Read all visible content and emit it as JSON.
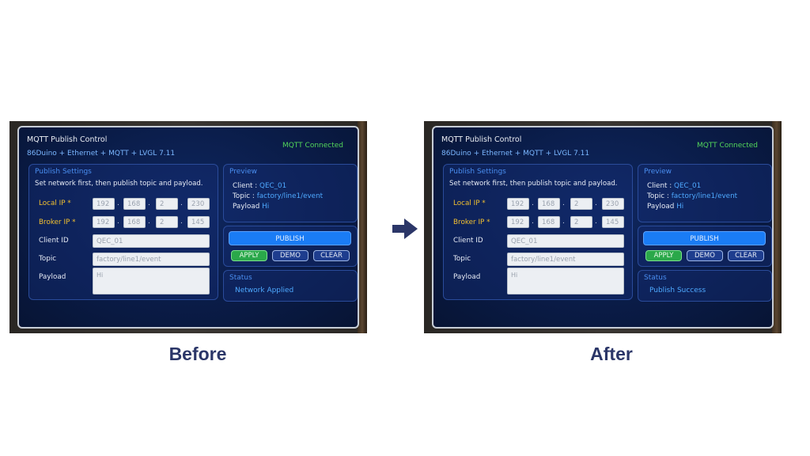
{
  "colors": {
    "caption": "#2b3668",
    "accent_blue": "#1a7cf5",
    "connected_green": "#53d65a",
    "required_label": "#f2c030",
    "screen_bg": "#0a1c48"
  },
  "arrow_icon": "right-arrow-icon",
  "panels": [
    {
      "caption": "Before",
      "header": {
        "title": "MQTT Publish Control",
        "subtitle": "86Duino + Ethernet + MQTT + LVGL 7.11",
        "connection": "MQTT Connected"
      },
      "settings": {
        "title": "Publish Settings",
        "hint": "Set network first, then publish topic and payload.",
        "local_ip_label": "Local IP *",
        "local_ip": [
          "192",
          "168",
          "2",
          "230"
        ],
        "broker_ip_label": "Broker IP *",
        "broker_ip": [
          "192",
          "168",
          "2",
          "145"
        ],
        "client_id_label": "Client ID",
        "client_id": "QEC_01",
        "topic_label": "Topic",
        "topic": "factory/line1/event",
        "payload_label": "Payload",
        "payload": "Hi"
      },
      "preview": {
        "title": "Preview",
        "client_label": "Client :",
        "client": "QEC_01",
        "topic_label": "Topic :",
        "topic": "factory/line1/event",
        "payload_label": "Payload",
        "payload": "Hi"
      },
      "buttons": {
        "publish": "PUBLISH",
        "apply": "APPLY",
        "demo": "DEMO",
        "clear": "CLEAR"
      },
      "status": {
        "title": "Status",
        "text": "Network Applied"
      }
    },
    {
      "caption": "After",
      "header": {
        "title": "MQTT Publish Control",
        "subtitle": "86Duino + Ethernet + MQTT + LVGL 7.11",
        "connection": "MQTT Connected"
      },
      "settings": {
        "title": "Publish Settings",
        "hint": "Set network first, then publish topic and payload.",
        "local_ip_label": "Local IP *",
        "local_ip": [
          "192",
          "168",
          "2",
          "230"
        ],
        "broker_ip_label": "Broker IP *",
        "broker_ip": [
          "192",
          "168",
          "2",
          "145"
        ],
        "client_id_label": "Client ID",
        "client_id": "QEC_01",
        "topic_label": "Topic",
        "topic": "factory/line1/event",
        "payload_label": "Payload",
        "payload": "Hi"
      },
      "preview": {
        "title": "Preview",
        "client_label": "Client :",
        "client": "QEC_01",
        "topic_label": "Topic :",
        "topic": "factory/line1/event",
        "payload_label": "Payload",
        "payload": "Hi"
      },
      "buttons": {
        "publish": "PUBLISH",
        "apply": "APPLY",
        "demo": "DEMO",
        "clear": "CLEAR"
      },
      "status": {
        "title": "Status",
        "text": "Publish Success"
      }
    }
  ]
}
